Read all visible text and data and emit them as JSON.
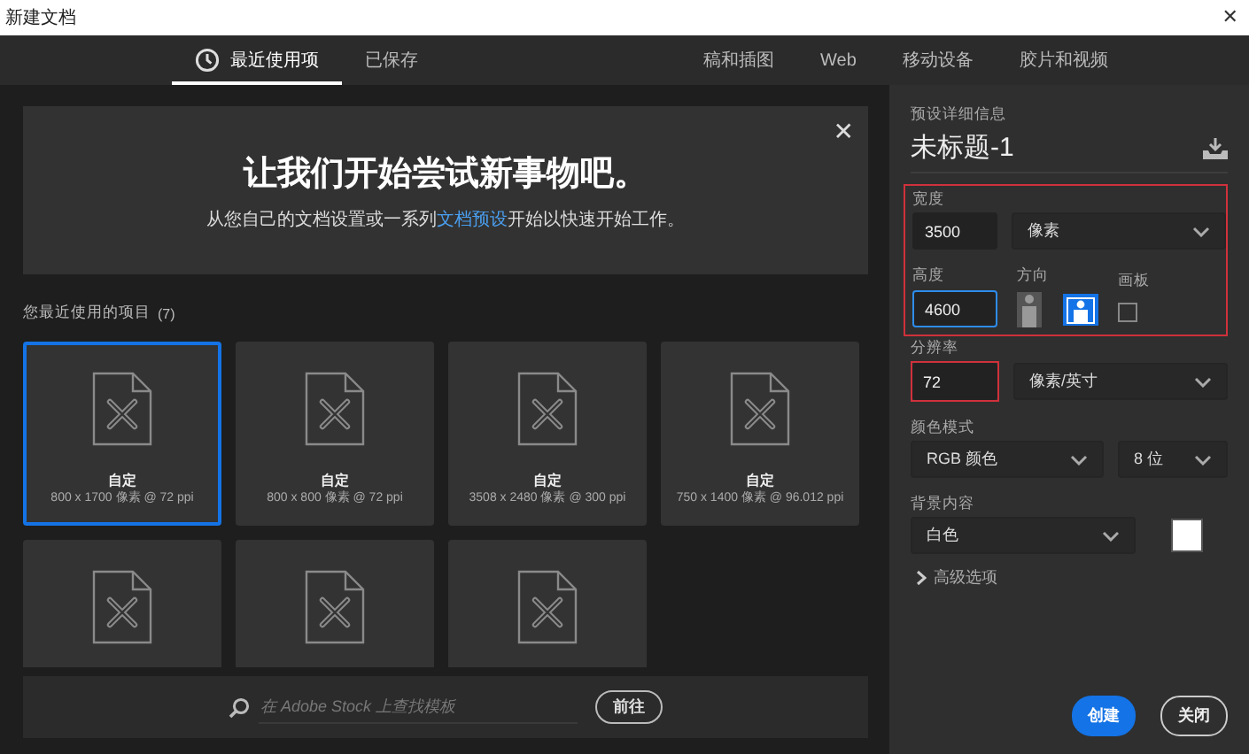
{
  "window": {
    "title": "新建文档",
    "close": "✕"
  },
  "tabs": [
    {
      "label": "最近使用项",
      "selected": true
    },
    {
      "label": "已保存",
      "selected": false
    },
    {
      "label": "稿和插图",
      "selected": false
    },
    {
      "label": "Web",
      "selected": false
    },
    {
      "label": "移动设备",
      "selected": false
    },
    {
      "label": "胶片和视频",
      "selected": false
    }
  ],
  "hero": {
    "title": "让我们开始尝试新事物吧。",
    "text": "从您自己的文档设置或一系列",
    "link": "文档预设",
    "text_after": "开始以快速开始工作。",
    "close": "✕"
  },
  "recent": {
    "heading": "您最近使用的项目",
    "count": "(7)",
    "items": [
      {
        "name": "自定",
        "size": "800 x 1700 像素 @ 72 ppi",
        "selected": true
      },
      {
        "name": "自定",
        "size": "800 x 800 像素 @ 72 ppi",
        "selected": false
      },
      {
        "name": "自定",
        "size": "3508 x 2480 像素 @ 300 ppi",
        "selected": false
      },
      {
        "name": "自定",
        "size": "750 x 1400 像素 @ 96.012 ppi",
        "selected": false
      },
      {
        "selected": false
      },
      {
        "selected": false
      },
      {
        "selected": false
      }
    ]
  },
  "search": {
    "placeholder": "在 Adobe Stock 上查找模板",
    "button": "前往"
  },
  "details": {
    "heading": "预设详细信息",
    "name": "未标题-1",
    "width": {
      "label": "宽度",
      "value": "3500",
      "unit": "像素"
    },
    "height": {
      "label": "高度",
      "value": "4600"
    },
    "orientation": {
      "label": "方向",
      "options": [
        {
          "kind": "portrait",
          "selected": false
        },
        {
          "kind": "landscape",
          "selected": true
        }
      ]
    },
    "artboard": {
      "label": "画板",
      "checked": false
    },
    "resolution": {
      "label": "分辨率",
      "value": "72",
      "unit": "像素/英寸"
    },
    "color_mode": {
      "label": "颜色模式",
      "value": "RGB 颜色",
      "depth": "8 位"
    },
    "background": {
      "label": "背景内容",
      "value": "白色",
      "color": "#ffffff"
    },
    "advanced": {
      "label": "高级选项",
      "expanded": false
    }
  },
  "buttons": [
    {
      "label": "创建",
      "kind": "primary"
    },
    {
      "label": "关闭",
      "kind": "secondary"
    }
  ]
}
